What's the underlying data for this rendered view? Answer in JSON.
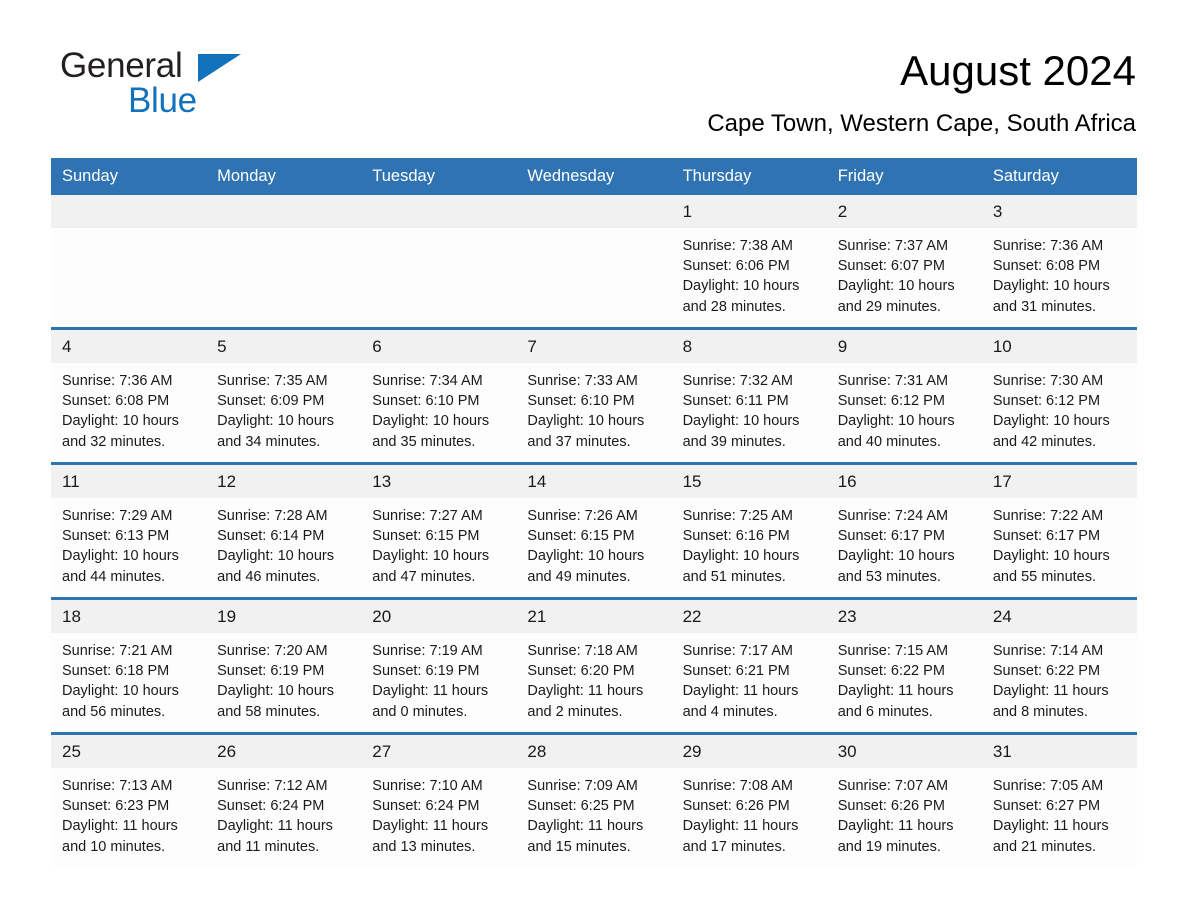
{
  "brand": {
    "name_part1": "General",
    "name_part2": "Blue",
    "accent_color": "#1272bb"
  },
  "header": {
    "title": "August 2024",
    "subtitle": "Cape Town, Western Cape, South Africa"
  },
  "theme": {
    "header_bg": "#3073b3",
    "daynum_bg": "#f1f1f1",
    "rule_color": "#3073b3"
  },
  "weekdays": [
    "Sunday",
    "Monday",
    "Tuesday",
    "Wednesday",
    "Thursday",
    "Friday",
    "Saturday"
  ],
  "weeks": [
    {
      "days": [
        {
          "num": "",
          "detail": ""
        },
        {
          "num": "",
          "detail": ""
        },
        {
          "num": "",
          "detail": ""
        },
        {
          "num": "",
          "detail": ""
        },
        {
          "num": "1",
          "detail": "Sunrise: 7:38 AM\nSunset: 6:06 PM\nDaylight: 10 hours\nand 28 minutes."
        },
        {
          "num": "2",
          "detail": "Sunrise: 7:37 AM\nSunset: 6:07 PM\nDaylight: 10 hours\nand 29 minutes."
        },
        {
          "num": "3",
          "detail": "Sunrise: 7:36 AM\nSunset: 6:08 PM\nDaylight: 10 hours\nand 31 minutes."
        }
      ]
    },
    {
      "days": [
        {
          "num": "4",
          "detail": "Sunrise: 7:36 AM\nSunset: 6:08 PM\nDaylight: 10 hours\nand 32 minutes."
        },
        {
          "num": "5",
          "detail": "Sunrise: 7:35 AM\nSunset: 6:09 PM\nDaylight: 10 hours\nand 34 minutes."
        },
        {
          "num": "6",
          "detail": "Sunrise: 7:34 AM\nSunset: 6:10 PM\nDaylight: 10 hours\nand 35 minutes."
        },
        {
          "num": "7",
          "detail": "Sunrise: 7:33 AM\nSunset: 6:10 PM\nDaylight: 10 hours\nand 37 minutes."
        },
        {
          "num": "8",
          "detail": "Sunrise: 7:32 AM\nSunset: 6:11 PM\nDaylight: 10 hours\nand 39 minutes."
        },
        {
          "num": "9",
          "detail": "Sunrise: 7:31 AM\nSunset: 6:12 PM\nDaylight: 10 hours\nand 40 minutes."
        },
        {
          "num": "10",
          "detail": "Sunrise: 7:30 AM\nSunset: 6:12 PM\nDaylight: 10 hours\nand 42 minutes."
        }
      ]
    },
    {
      "days": [
        {
          "num": "11",
          "detail": "Sunrise: 7:29 AM\nSunset: 6:13 PM\nDaylight: 10 hours\nand 44 minutes."
        },
        {
          "num": "12",
          "detail": "Sunrise: 7:28 AM\nSunset: 6:14 PM\nDaylight: 10 hours\nand 46 minutes."
        },
        {
          "num": "13",
          "detail": "Sunrise: 7:27 AM\nSunset: 6:15 PM\nDaylight: 10 hours\nand 47 minutes."
        },
        {
          "num": "14",
          "detail": "Sunrise: 7:26 AM\nSunset: 6:15 PM\nDaylight: 10 hours\nand 49 minutes."
        },
        {
          "num": "15",
          "detail": "Sunrise: 7:25 AM\nSunset: 6:16 PM\nDaylight: 10 hours\nand 51 minutes."
        },
        {
          "num": "16",
          "detail": "Sunrise: 7:24 AM\nSunset: 6:17 PM\nDaylight: 10 hours\nand 53 minutes."
        },
        {
          "num": "17",
          "detail": "Sunrise: 7:22 AM\nSunset: 6:17 PM\nDaylight: 10 hours\nand 55 minutes."
        }
      ]
    },
    {
      "days": [
        {
          "num": "18",
          "detail": "Sunrise: 7:21 AM\nSunset: 6:18 PM\nDaylight: 10 hours\nand 56 minutes."
        },
        {
          "num": "19",
          "detail": "Sunrise: 7:20 AM\nSunset: 6:19 PM\nDaylight: 10 hours\nand 58 minutes."
        },
        {
          "num": "20",
          "detail": "Sunrise: 7:19 AM\nSunset: 6:19 PM\nDaylight: 11 hours\nand 0 minutes."
        },
        {
          "num": "21",
          "detail": "Sunrise: 7:18 AM\nSunset: 6:20 PM\nDaylight: 11 hours\nand 2 minutes."
        },
        {
          "num": "22",
          "detail": "Sunrise: 7:17 AM\nSunset: 6:21 PM\nDaylight: 11 hours\nand 4 minutes."
        },
        {
          "num": "23",
          "detail": "Sunrise: 7:15 AM\nSunset: 6:22 PM\nDaylight: 11 hours\nand 6 minutes."
        },
        {
          "num": "24",
          "detail": "Sunrise: 7:14 AM\nSunset: 6:22 PM\nDaylight: 11 hours\nand 8 minutes."
        }
      ]
    },
    {
      "days": [
        {
          "num": "25",
          "detail": "Sunrise: 7:13 AM\nSunset: 6:23 PM\nDaylight: 11 hours\nand 10 minutes."
        },
        {
          "num": "26",
          "detail": "Sunrise: 7:12 AM\nSunset: 6:24 PM\nDaylight: 11 hours\nand 11 minutes."
        },
        {
          "num": "27",
          "detail": "Sunrise: 7:10 AM\nSunset: 6:24 PM\nDaylight: 11 hours\nand 13 minutes."
        },
        {
          "num": "28",
          "detail": "Sunrise: 7:09 AM\nSunset: 6:25 PM\nDaylight: 11 hours\nand 15 minutes."
        },
        {
          "num": "29",
          "detail": "Sunrise: 7:08 AM\nSunset: 6:26 PM\nDaylight: 11 hours\nand 17 minutes."
        },
        {
          "num": "30",
          "detail": "Sunrise: 7:07 AM\nSunset: 6:26 PM\nDaylight: 11 hours\nand 19 minutes."
        },
        {
          "num": "31",
          "detail": "Sunrise: 7:05 AM\nSunset: 6:27 PM\nDaylight: 11 hours\nand 21 minutes."
        }
      ]
    }
  ]
}
